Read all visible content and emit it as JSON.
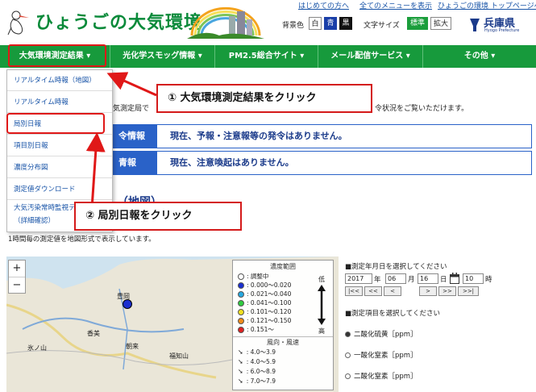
{
  "header": {
    "logo_text": "ひょうごの大気環境",
    "top_links": [
      "はじめての方へ",
      "全てのメニューを表示",
      "ひょうごの環境 トップページへ"
    ],
    "bg_label": "背景色",
    "bg_options": [
      "白",
      "青",
      "黒"
    ],
    "fontsize_label": "文字サイズ",
    "fontsize_options": [
      "標準",
      "拡大"
    ],
    "pref_name": "兵庫県",
    "pref_sub": "Hyogo Prefecture"
  },
  "nav": {
    "items": [
      "大気環境測定結果 ▾",
      "光化学スモッグ情報 ▾",
      "PM2.5総合サイト ▾",
      "メール配信サービス ▾",
      "その他 ▾"
    ]
  },
  "dropdown": {
    "items": [
      "リアルタイム時報（地図）",
      "リアルタイム時報",
      "局別日報",
      "項目別日報",
      "濃度分布図",
      "測定値ダウンロード",
      "大気汚染常時監視テ",
      "（詳細確認）"
    ]
  },
  "main": {
    "intro_fragment": "気測定局で",
    "intro_tail": "令状況をご覧いただけます。",
    "alerts": [
      {
        "head": "令情報",
        "text": "現在、予報・注意報等の発令はありません。"
      },
      {
        "head": "青報",
        "text": "現在、注意喚起はありません。"
      }
    ],
    "section_title_fragment": "（地図）",
    "time_note": "1時間毎の測定値を地図形式で表示しています。"
  },
  "callouts": {
    "first": "① 大気環境測定結果をクリック",
    "second": "② 局別日報をクリック"
  },
  "map": {
    "zoom_in": "+",
    "zoom_out": "−",
    "legend_title": "濃度範囲",
    "legend_rows": [
      {
        "label": ": 調整中",
        "color": "#ffffff"
      },
      {
        "label": ": 0.000～0.020",
        "color": "#1a2fd0"
      },
      {
        "label": ": 0.021～0.040",
        "color": "#26a8e0"
      },
      {
        "label": ": 0.041～0.100",
        "color": "#2ecc40"
      },
      {
        "label": ": 0.101～0.120",
        "color": "#f0e020"
      },
      {
        "label": ": 0.121～0.150",
        "color": "#f08c1a"
      },
      {
        "label": ": 0.151～",
        "color": "#e02020"
      }
    ],
    "low_label": "低",
    "high_label": "高",
    "wind_title": "風向・風速",
    "wind_rows": [
      ": 4.0～3.9",
      ": 4.0～5.9",
      ": 6.0～8.9",
      ": 7.0～7.9"
    ],
    "place_labels": [
      "豊岡",
      "香美",
      "朝来",
      "福知山",
      "氷ノ山"
    ]
  },
  "controls": {
    "date_title": "■測定年月日を選択してください",
    "year": "2017",
    "year_unit": "年",
    "month": "06",
    "month_unit": "月",
    "day": "16",
    "day_unit": "日",
    "hour": "10",
    "hour_unit": "時",
    "nav_buttons": [
      "|<<",
      "<<",
      "<",
      ">",
      ">>",
      ">>|"
    ],
    "item_title": "■測定項目を選択してください",
    "items": [
      "二酸化硫黄［ppm］",
      "一酸化窒素［ppm］",
      "二酸化窒素［ppm］"
    ]
  }
}
